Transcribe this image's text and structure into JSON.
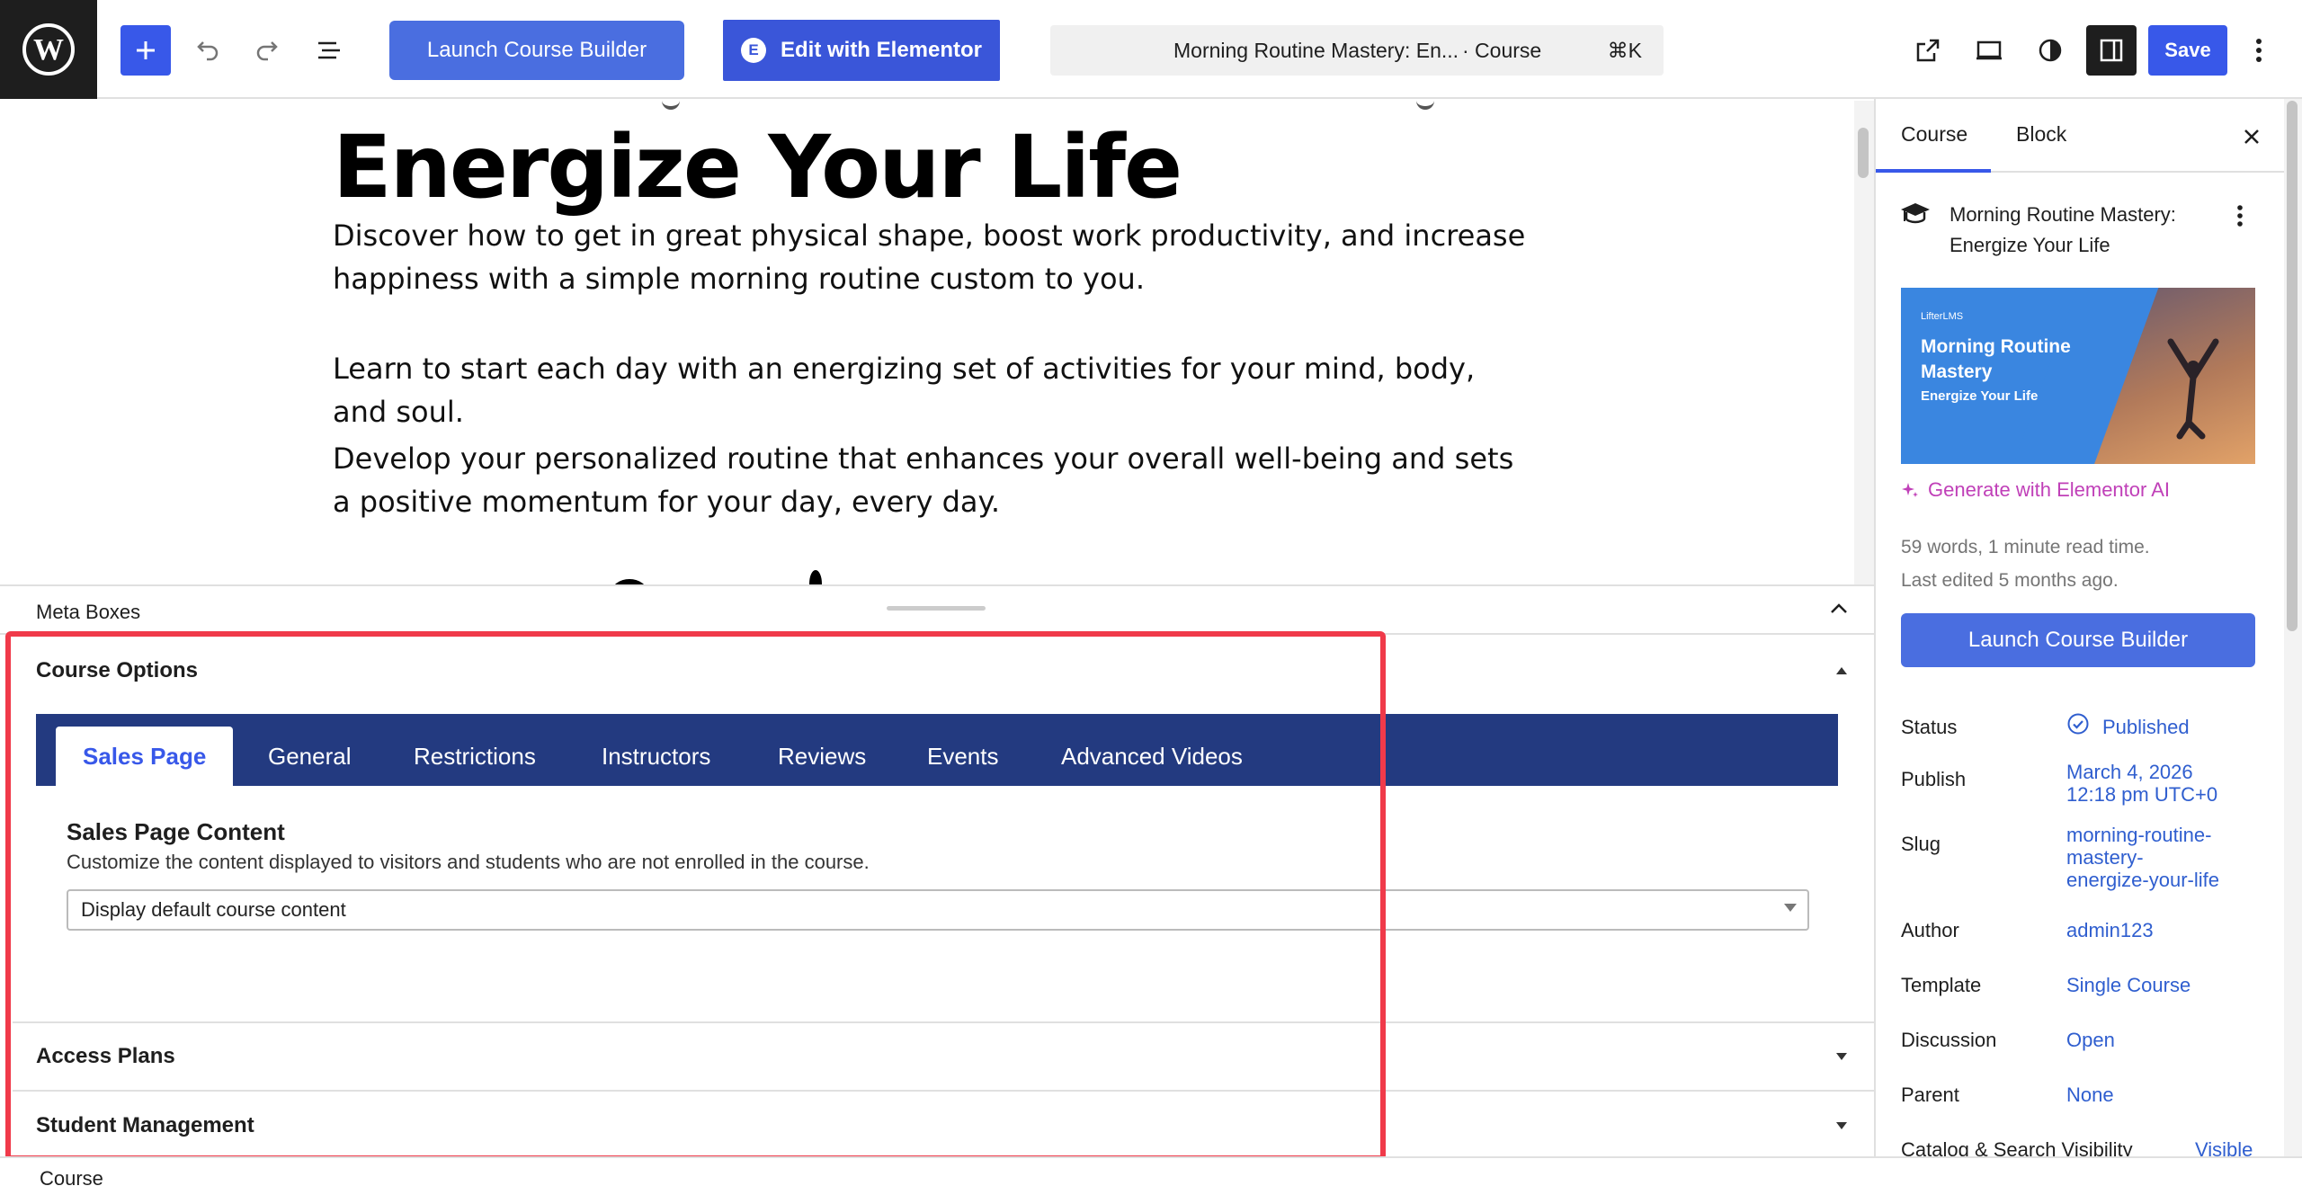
{
  "toolbar": {
    "launch_course_builder": "Launch Course Builder",
    "edit_with_elementor": "Edit with Elementor",
    "command_title": "Morning Routine Mastery: En...",
    "command_type": "· Course",
    "command_shortcut": "⌘K",
    "save_label": "Save"
  },
  "canvas": {
    "headline": "Energize Your Life",
    "paragraphs": [
      "Discover how to get in great physical shape, boost work productivity, and increase happiness with a simple morning routine custom to you.",
      "Learn to start each day with an energizing set of activities for your mind, body, and soul.",
      "Develop your personalized routine that enhances your overall well-being and sets a positive momentum for your day, every day."
    ]
  },
  "meta": {
    "header_label": "Meta Boxes",
    "course_options": {
      "title": "Course Options",
      "tabs": [
        "Sales Page",
        "General",
        "Restrictions",
        "Instructors",
        "Reviews",
        "Events",
        "Advanced Videos"
      ],
      "active_tab": "Sales Page",
      "sales_page": {
        "title": "Sales Page Content",
        "description": "Customize the content displayed to visitors and students who are not enrolled in the course.",
        "select_value": "Display default course content"
      }
    },
    "access_plans": "Access Plans",
    "student_management": "Student Management"
  },
  "footer": {
    "breadcrumb": "Course"
  },
  "sidebar": {
    "tabs": [
      "Course",
      "Block"
    ],
    "active_tab": "Course",
    "course_title": "Morning Routine Mastery: Energize Your Life",
    "featured_image": {
      "brand": "LifterLMS",
      "title": "Morning Routine Mastery",
      "subtitle": "Energize Your Life"
    },
    "generate_ai": "Generate with Elementor AI",
    "stats_words": "59 words, 1 minute read time.",
    "stats_edited": "Last edited 5 months ago.",
    "launch_course_builder": "Launch Course Builder",
    "rows": {
      "status": {
        "label": "Status",
        "value": "Published"
      },
      "publish": {
        "label": "Publish",
        "value_line1": "March 4, 2026",
        "value_line2": "12:18 pm UTC+0"
      },
      "slug": {
        "label": "Slug",
        "value_line1": "morning-routine-",
        "value_line2": "mastery-",
        "value_line3": "energize-your-life"
      },
      "author": {
        "label": "Author",
        "value": "admin123"
      },
      "template": {
        "label": "Template",
        "value": "Single Course"
      },
      "discussion": {
        "label": "Discussion",
        "value": "Open"
      },
      "parent": {
        "label": "Parent",
        "value": "None"
      },
      "visibility": {
        "label": "Catalog & Search Visibility",
        "value": "Visible"
      }
    }
  },
  "colors": {
    "accent": "#3858e9",
    "tabbar": "#233a80",
    "highlight": "#f03a4a",
    "link": "#2f5ecf",
    "ai": "#c040b8"
  }
}
